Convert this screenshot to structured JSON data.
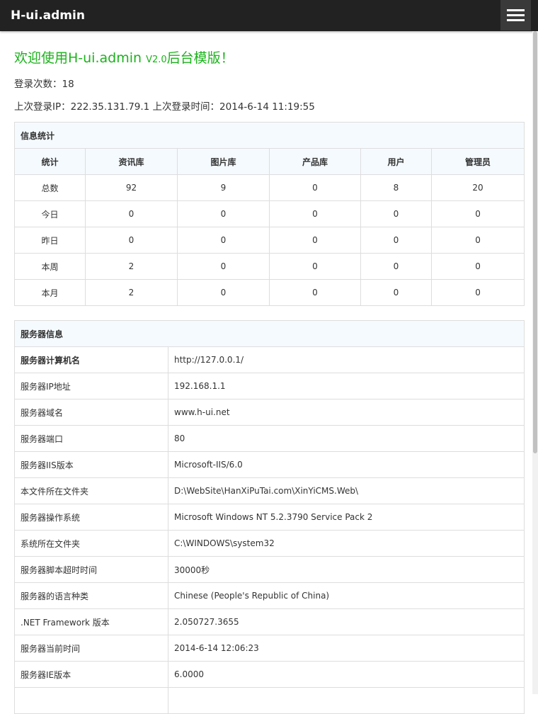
{
  "navbar": {
    "brand": "H-ui.admin",
    "menu_icon": "hamburger-menu-icon"
  },
  "welcome": {
    "text": "欢迎使用H-ui.admin ",
    "version": "V2.0",
    "suffix": "后台模版！"
  },
  "login": {
    "count_text": "登录次数：18",
    "last_login_text": "上次登录IP：222.35.131.79.1 上次登录时间：2014-6-14 11:19:55"
  },
  "stats": {
    "caption": "信息统计",
    "headers": [
      "统计",
      "资讯库",
      "图片库",
      "产品库",
      "用户",
      "管理员"
    ],
    "rows": [
      [
        "总数",
        "92",
        "9",
        "0",
        "8",
        "20"
      ],
      [
        "今日",
        "0",
        "0",
        "0",
        "0",
        "0"
      ],
      [
        "昨日",
        "0",
        "0",
        "0",
        "0",
        "0"
      ],
      [
        "本周",
        "2",
        "0",
        "0",
        "0",
        "0"
      ],
      [
        "本月",
        "2",
        "0",
        "0",
        "0",
        "0"
      ]
    ]
  },
  "server": {
    "caption": "服务器信息",
    "rows": [
      [
        "服务器计算机名",
        "http://127.0.0.1/"
      ],
      [
        "服务器IP地址",
        "192.168.1.1"
      ],
      [
        "服务器域名",
        "www.h-ui.net"
      ],
      [
        "服务器端口",
        "80"
      ],
      [
        "服务器IIS版本",
        "Microsoft-IIS/6.0"
      ],
      [
        "本文件所在文件夹",
        "D:\\WebSite\\HanXiPuTai.com\\XinYiCMS.Web\\"
      ],
      [
        "服务器操作系统",
        "Microsoft Windows NT 5.2.3790 Service Pack 2"
      ],
      [
        "系统所在文件夹",
        "C:\\WINDOWS\\system32"
      ],
      [
        "服务器脚本超时时间",
        "30000秒"
      ],
      [
        "服务器的语言种类",
        "Chinese (People's Republic of China)"
      ],
      [
        ".NET Framework 版本",
        "2.050727.3655"
      ],
      [
        "服务器当前时间",
        "2014-6-14 12:06:23"
      ],
      [
        "服务器IE版本",
        "6.0000"
      ],
      [
        "",
        ""
      ]
    ]
  },
  "colors": {
    "navbar_bg": "#222222",
    "accent_green": "#1bb31b",
    "table_header_bg": "#f5fafe",
    "border": "#dddddd"
  }
}
